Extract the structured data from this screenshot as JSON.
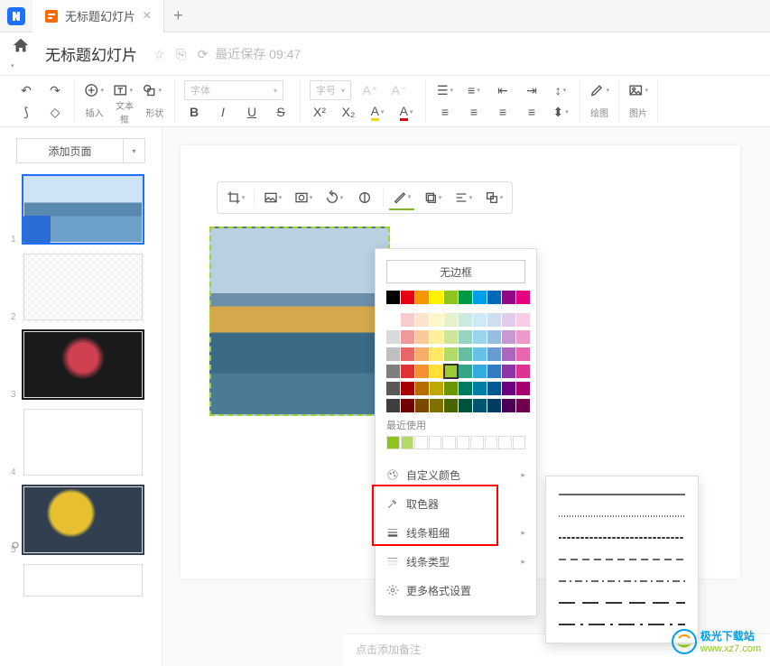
{
  "tab": {
    "title": "无标题幻灯片"
  },
  "header": {
    "title": "无标题幻灯片",
    "save_status": "最近保存 09:47"
  },
  "toolbar": {
    "groups": {
      "insert": "插入",
      "textbox": "文本框",
      "shape": "形状",
      "font_placeholder": "字体",
      "size_placeholder": "字号",
      "draw": "绘图",
      "image": "图片"
    }
  },
  "sidebar": {
    "add_page": "添加页面",
    "thumbs": [
      1,
      2,
      3,
      4,
      5
    ]
  },
  "border_dropdown": {
    "no_border": "无边框",
    "standard_row": [
      "#000000",
      "#e60012",
      "#f39800",
      "#fff100",
      "#8fc31f",
      "#009944",
      "#00a0e9",
      "#0068b7",
      "#920783",
      "#e4007f"
    ],
    "theme_grid": [
      [
        "#ffffff",
        "#f7cccc",
        "#fce4cc",
        "#fff7cc",
        "#e6f2cc",
        "#cce9e0",
        "#cceaf7",
        "#ccdef0",
        "#e3cce9",
        "#f7cce4"
      ],
      [
        "#d9d9d9",
        "#ef9999",
        "#f9c999",
        "#fff099",
        "#cde699",
        "#99d3c1",
        "#99d5ef",
        "#99bde1",
        "#c799d3",
        "#ef99c9"
      ],
      [
        "#bfbfbf",
        "#e76666",
        "#f6ad66",
        "#ffe866",
        "#b3d966",
        "#66bda2",
        "#66c0e7",
        "#669cd2",
        "#ab66bd",
        "#e766ad"
      ],
      [
        "#7f7f7f",
        "#df3333",
        "#f39233",
        "#ffe033",
        "#9acc33",
        "#33a783",
        "#33abdf",
        "#337bc3",
        "#8f33a7",
        "#df3392"
      ],
      [
        "#595959",
        "#a60000",
        "#b66d00",
        "#bfa800",
        "#6b9600",
        "#007b5f",
        "#007fa6",
        "#005a91",
        "#6a007b",
        "#a6006d"
      ],
      [
        "#3f3f3f",
        "#700000",
        "#7a4900",
        "#807000",
        "#476400",
        "#00523f",
        "#005570",
        "#003c61",
        "#470052",
        "#700049"
      ]
    ],
    "selected_color": "#9acc33",
    "recent_label": "最近使用",
    "recent": [
      "#8fc31f",
      "#b3d966"
    ],
    "menu": {
      "custom_color": "自定义颜色",
      "eyedropper": "取色器",
      "line_weight": "线条粗细",
      "line_type": "线条类型",
      "more": "更多格式设置"
    }
  },
  "notes": {
    "placeholder": "点击添加备注"
  },
  "watermark": {
    "site": "极光下载站",
    "url": "www.xz7.com"
  },
  "chart_data": null
}
